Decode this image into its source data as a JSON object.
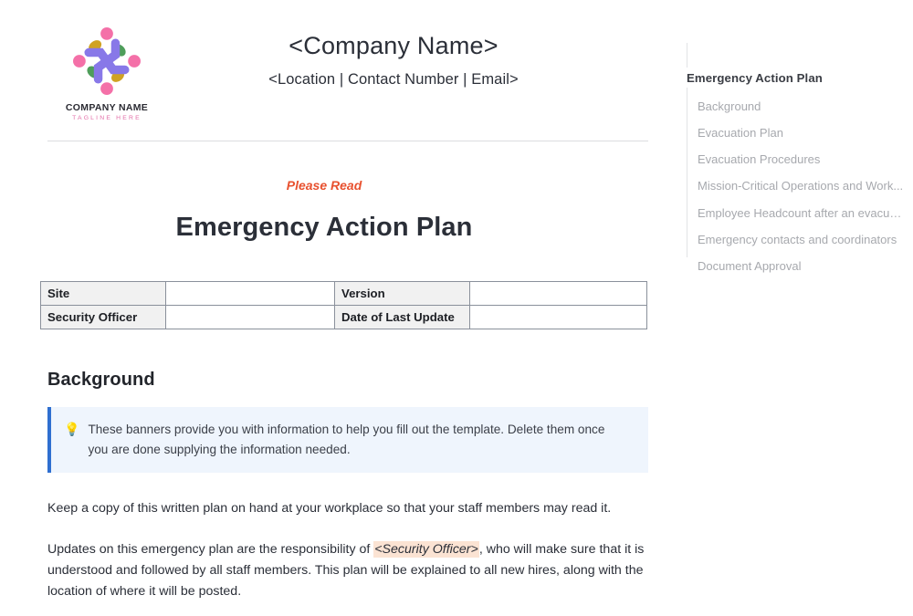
{
  "letterhead": {
    "logo": {
      "caption_name": "COMPANY NAME",
      "caption_tagline": "TAGLINE HERE",
      "colors": {
        "arm": "#8878e8",
        "head": "#f470a8",
        "accent_green": "#4e9e5a",
        "accent_gold": "#d0a223",
        "tagline": "#e36fa8",
        "caption": "#2b2b33"
      }
    },
    "company_name": "<Company Name>",
    "contact_line": "<Location | Contact Number | Email>"
  },
  "title_block": {
    "eyebrow": "Please Read",
    "eyebrow_color": "#e8512f",
    "title": "Emergency Action Plan"
  },
  "meta_table": {
    "rows": [
      {
        "label_a": "Site",
        "value_a": "",
        "label_b": "Version",
        "value_b": ""
      },
      {
        "label_a": "Security Officer",
        "value_a": "",
        "label_b": "Date of Last Update",
        "value_b": ""
      }
    ]
  },
  "section": {
    "heading": "Background",
    "callout": {
      "icon": "lightbulb-icon",
      "icon_glyph": "💡",
      "text": "These banners provide you with information to help you fill out the template. Delete them once you are done supplying the information needed.",
      "accent_color": "#2f6fd0",
      "background_color": "#eff5fd"
    },
    "paragraph_1": "Keep a copy of this written plan on hand at your workplace so that your staff members may read it.",
    "paragraph_2_before": "Updates on this emergency plan are the responsibility of ",
    "paragraph_2_placeholder": "<Security Officer>",
    "paragraph_2_after": ", who will make sure that it is understood and followed by all staff members. This plan will be explained to all new hires, along with the location of where it will be posted.",
    "placeholder_highlight_color": "#fbe3d3"
  },
  "outline": {
    "title": "Emergency Action Plan",
    "items": [
      {
        "label": "Background"
      },
      {
        "label": "Evacuation Plan"
      },
      {
        "label": "Evacuation Procedures"
      },
      {
        "label": "Mission-Critical Operations and Work..."
      },
      {
        "label": "Employee Headcount after an evacua..."
      },
      {
        "label": "Emergency contacts and coordinators"
      },
      {
        "label": "Document Approval"
      }
    ]
  }
}
